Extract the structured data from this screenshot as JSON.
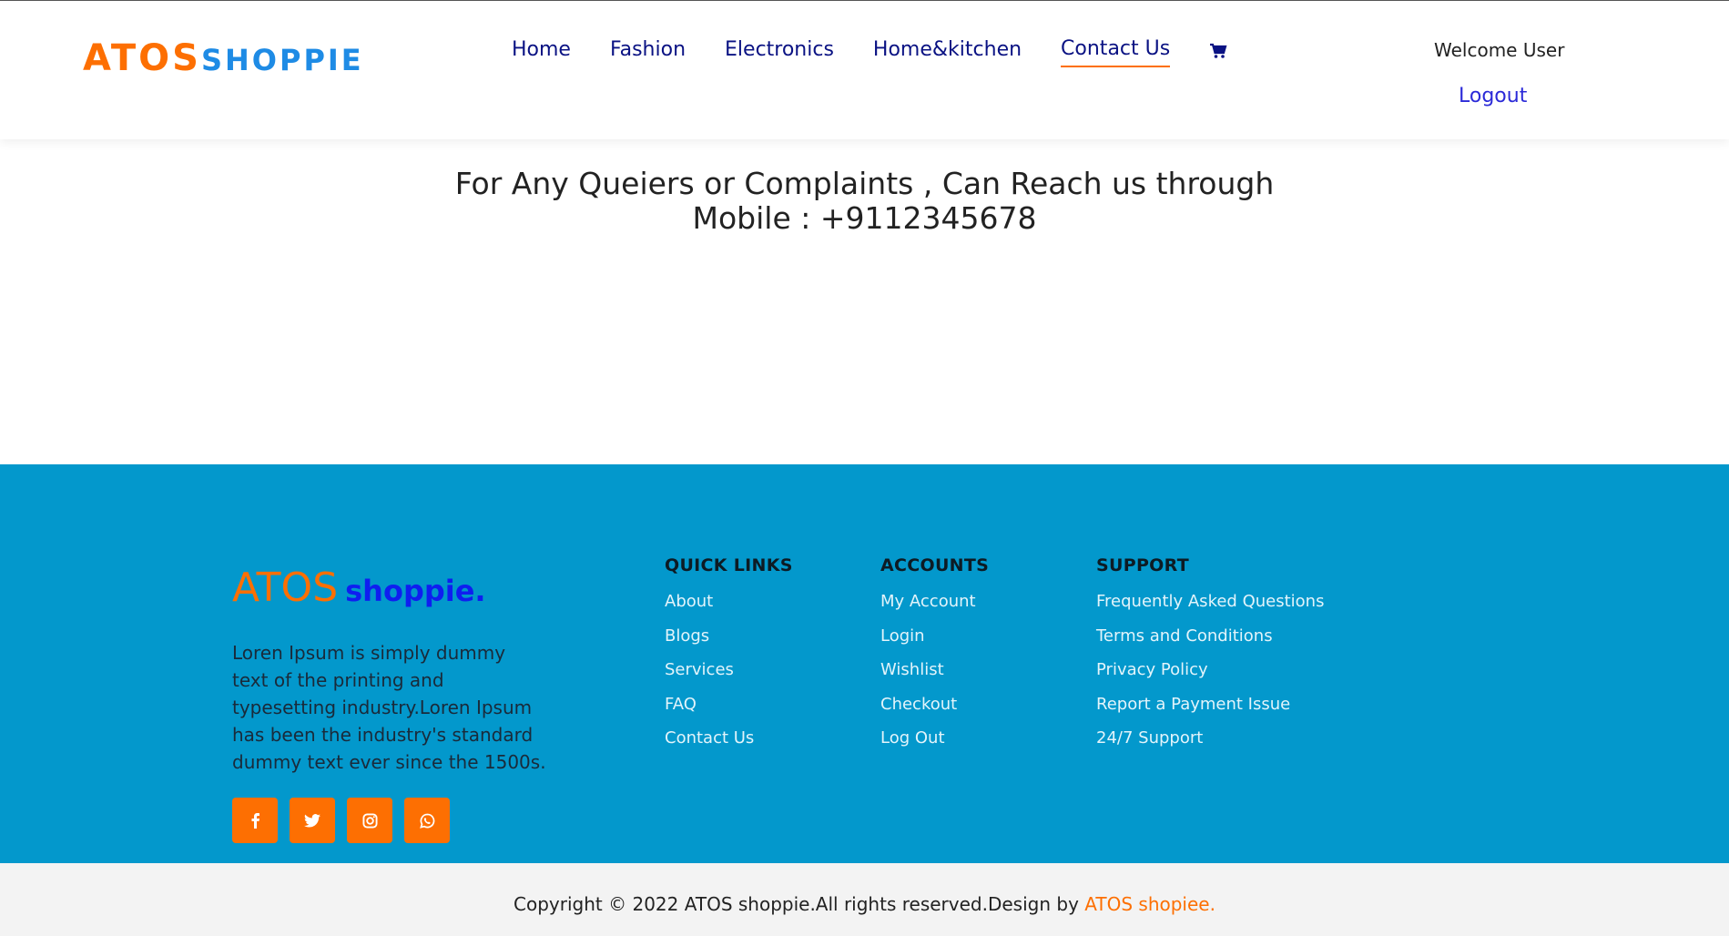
{
  "header": {
    "logo_part1": "ATOS",
    "logo_part2": "SHOPPIE",
    "nav": [
      {
        "label": "Home"
      },
      {
        "label": "Fashion"
      },
      {
        "label": "Electronics"
      },
      {
        "label": "Home&kitchen"
      },
      {
        "label": "Contact Us"
      }
    ],
    "cart_icon": "cart-icon",
    "welcome": "Welcome User",
    "logout": "Logout"
  },
  "main": {
    "line1": "For Any Queiers or Complaints , Can Reach us through",
    "line2": "Mobile : +9112345678"
  },
  "footer": {
    "logo_part1": "ATOS",
    "logo_part2": "shoppie.",
    "description": "Loren Ipsum is simply dummy text of the printing and typesetting industry.Loren Ipsum has been the industry's standard dummy text ever since the 1500s.",
    "social_icons": [
      "facebook-icon",
      "twitter-icon",
      "instagram-icon",
      "whatsapp-icon"
    ],
    "quick_links": {
      "title": "QUICK LINKS",
      "items": [
        "About",
        "Blogs",
        "Services",
        "FAQ",
        "Contact Us"
      ]
    },
    "accounts": {
      "title": "ACCOUNTS",
      "items": [
        "My Account",
        "Login",
        "Wishlist",
        "Checkout",
        "Log Out"
      ]
    },
    "support": {
      "title": "SUPPORT",
      "items": [
        "Frequently Asked Questions",
        "Terms and Conditions",
        "Privacy Policy",
        "Report a Payment Issue",
        "24/7 Support"
      ]
    },
    "copyright": "Copyright © 2022 ATOS shoppie.All rights reserved.Design by",
    "copyright_brand": "ATOS shopiee."
  },
  "colors": {
    "accent": "#fd6f02",
    "logo_blue": "#1e8be5",
    "nav": "#0a1283",
    "footer_bg": "#0398cc"
  }
}
